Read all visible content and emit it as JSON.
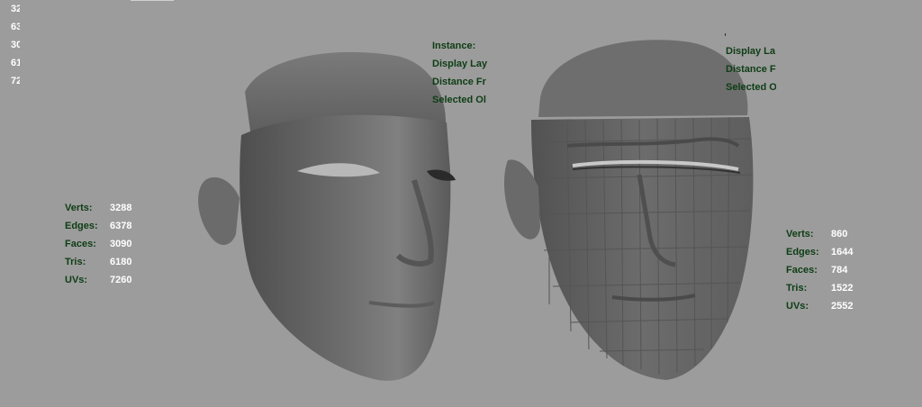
{
  "viewport": {
    "top_left_values": [
      "32",
      "63",
      "30",
      "61",
      "72"
    ],
    "info_center": {
      "instance_label": "Instance:",
      "display_layer_label": "Display Lay",
      "distance_label": "Distance Fr",
      "selected_label": "Selected Ol"
    },
    "info_right": {
      "display_layer_label": "Display La",
      "distance_label": "Distance F",
      "selected_label": "Selected O"
    },
    "left_model_stats": {
      "verts_label": "Verts:",
      "verts": "3288",
      "edges_label": "Edges:",
      "edges": "6378",
      "faces_label": "Faces:",
      "faces": "3090",
      "tris_label": "Tris:",
      "tris": "6180",
      "uvs_label": "UVs:",
      "uvs": "7260"
    },
    "right_model_stats": {
      "verts_label": "Verts:",
      "verts": "860",
      "edges_label": "Edges:",
      "edges": "1644",
      "faces_label": "Faces:",
      "faces": "784",
      "tris_label": "Tris:",
      "tris": "1522",
      "uvs_label": "UVs:",
      "uvs": "2552"
    },
    "colors": {
      "background": "#9c9c9c",
      "hud_label": "#0d3d14",
      "hud_value": "#ffffff",
      "mesh": "#6e6e6e"
    }
  }
}
